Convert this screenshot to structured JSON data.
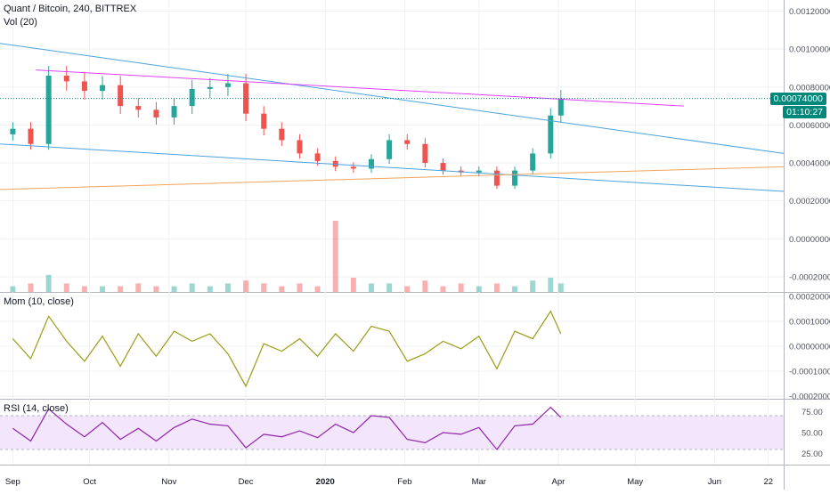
{
  "header": {
    "symbol": "Quant / Bitcoin, 240, BITTREX",
    "volume_legend": "Vol (20)",
    "momentum_legend": "Mom (10, close)",
    "rsi_legend": "RSI (14, close)"
  },
  "price_tags": {
    "last_price": "0.00074000",
    "countdown": "01:10:27"
  },
  "colors": {
    "up": "#26a69a",
    "down": "#ef5350",
    "channel": "#4aa3df",
    "resistance": "#e040fb",
    "support": "#f3a35b",
    "momentum": "#9c9c16",
    "rsi": "#8e24aa",
    "rsi_band": "#f3e5fb",
    "last_price": "#00897b"
  },
  "chart_data": [
    {
      "type": "candlestick",
      "title": "Quant / Bitcoin, 240, BITTREX",
      "x_ticks": [
        "Sep",
        "Oct",
        "Nov",
        "Dec",
        "2020",
        "Feb",
        "Mar",
        "Apr",
        "May",
        "Jun",
        "22"
      ],
      "y_ticks": [
        "0.00120000",
        "0.00100000",
        "0.00080000",
        "0.00060000",
        "0.00040000",
        "0.00020000",
        "0.00000000",
        "-0.00020000"
      ],
      "ylim": [
        -0.00028,
        0.00124
      ],
      "series": [
        {
          "name": "Quant / Bitcoin",
          "x": [
            "2019-09-01",
            "2019-09-08",
            "2019-09-15",
            "2019-09-22",
            "2019-09-29",
            "2019-10-06",
            "2019-10-13",
            "2019-10-20",
            "2019-10-27",
            "2019-11-03",
            "2019-11-10",
            "2019-11-17",
            "2019-11-24",
            "2019-12-01",
            "2019-12-08",
            "2019-12-15",
            "2019-12-22",
            "2019-12-29",
            "2020-01-05",
            "2020-01-12",
            "2020-01-19",
            "2020-01-26",
            "2020-02-02",
            "2020-02-09",
            "2020-02-16",
            "2020-02-23",
            "2020-03-01",
            "2020-03-08",
            "2020-03-15",
            "2020-03-22",
            "2020-03-29",
            "2020-04-02"
          ],
          "close": [
            0.00058,
            0.0005,
            0.00086,
            0.00083,
            0.00078,
            0.00081,
            0.0007,
            0.00068,
            0.00064,
            0.0007,
            0.00079,
            0.0008,
            0.00082,
            0.00066,
            0.00058,
            0.00052,
            0.00045,
            0.00041,
            0.00038,
            0.00037,
            0.00042,
            0.00052,
            0.0005,
            0.0004,
            0.00036,
            0.00035,
            0.00036,
            0.00028,
            0.00036,
            0.00045,
            0.00065,
            0.00074
          ]
        }
      ],
      "volume": [
        0.02,
        0.03,
        0.06,
        0.03,
        0.02,
        0.02,
        0.02,
        0.03,
        0.02,
        0.02,
        0.03,
        0.02,
        0.03,
        0.04,
        0.03,
        0.02,
        0.03,
        0.02,
        0.25,
        0.05,
        0.03,
        0.03,
        0.02,
        0.04,
        0.02,
        0.03,
        0.02,
        0.03,
        0.02,
        0.04,
        0.05,
        0.03
      ],
      "annotations": [
        "descending channel (two lines)",
        "resistance trendline",
        "rising support trendline",
        "last price line 0.00074000"
      ]
    },
    {
      "type": "line",
      "title": "Mom (10, close)",
      "y_ticks": [
        "0.00020000",
        "0.00010000",
        "0.00000000",
        "-0.00010000",
        "-0.00020000"
      ],
      "ylim": [
        -0.00021,
        0.00021
      ],
      "series": [
        {
          "name": "Mom (10, close)",
          "values": [
            3e-05,
            -5e-05,
            0.00012,
            2e-05,
            -6e-05,
            4e-05,
            -8e-05,
            5e-05,
            -4e-05,
            6e-05,
            2e-05,
            5e-05,
            -3e-05,
            -0.00016,
            1e-05,
            -2e-05,
            3e-05,
            -4e-05,
            5e-05,
            -2e-05,
            8e-05,
            6e-05,
            -6e-05,
            -3e-05,
            2e-05,
            -1e-05,
            4e-05,
            -9e-05,
            6e-05,
            3e-05,
            0.00014,
            5e-05
          ]
        }
      ]
    },
    {
      "type": "line",
      "title": "RSI (14, close)",
      "y_ticks": [
        "75.00",
        "50.00",
        "25.00"
      ],
      "ylim": [
        12,
        88
      ],
      "band": [
        30,
        70
      ],
      "series": [
        {
          "name": "RSI (14, close)",
          "values": [
            55,
            40,
            78,
            60,
            45,
            62,
            42,
            55,
            40,
            56,
            66,
            60,
            58,
            32,
            48,
            45,
            52,
            44,
            60,
            50,
            70,
            68,
            42,
            38,
            50,
            48,
            56,
            30,
            58,
            60,
            80,
            68
          ]
        }
      ]
    }
  ]
}
